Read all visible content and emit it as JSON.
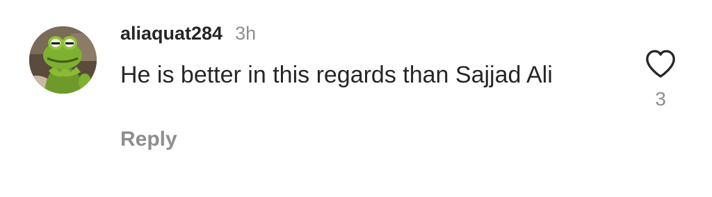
{
  "comment": {
    "username": "aliaquat284",
    "timestamp": "3h",
    "text": "He is better in this regards than Sajjad Ali",
    "reply_label": "Reply",
    "like_count": "3"
  },
  "icons": {
    "avatar": "frog-puppet-avatar",
    "like": "heart-outline-icon"
  },
  "colors": {
    "primary_text": "#262626",
    "secondary_text": "#8e8e8e",
    "background": "#ffffff"
  }
}
